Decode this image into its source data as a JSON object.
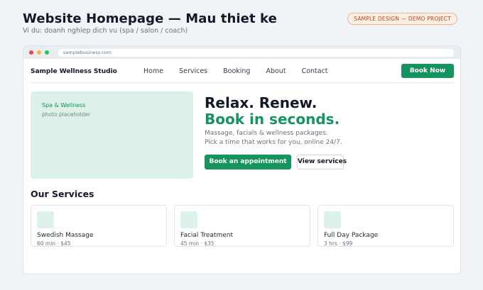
{
  "header": {
    "title": "Website Homepage — Mau thiet ke",
    "subtitle": "Vi du: doanh nghiep dich vu (spa / salon / coach)",
    "badge": "SAMPLE DESIGN — DEMO PROJECT"
  },
  "browser": {
    "url": "samplebusiness.com"
  },
  "site": {
    "brand": "Sample Wellness Studio",
    "nav": [
      "Home",
      "Services",
      "Booking",
      "About",
      "Contact"
    ],
    "cta": "Book Now"
  },
  "hero": {
    "image_tag": "Spa & Wellness",
    "image_placeholder": "photo placeholder",
    "title_line1": "Relax. Renew.",
    "title_line2": "Book in seconds.",
    "desc_line1": "Massage, facials & wellness packages.",
    "desc_line2": "Pick a time that works for you, online 24/7.",
    "primary_button": "Book an appointment",
    "secondary_button": "View services"
  },
  "services": {
    "heading": "Our Services",
    "items": [
      {
        "name": "Swedish Massage",
        "meta": "60 min · $45"
      },
      {
        "name": "Facial Treatment",
        "meta": "45 min · $35"
      },
      {
        "name": "Full Day Package",
        "meta": "3 hrs · $99"
      }
    ]
  },
  "colors": {
    "accent": "#15945f",
    "accent_light": "#dcf1e8",
    "badge": "#c2410c"
  }
}
